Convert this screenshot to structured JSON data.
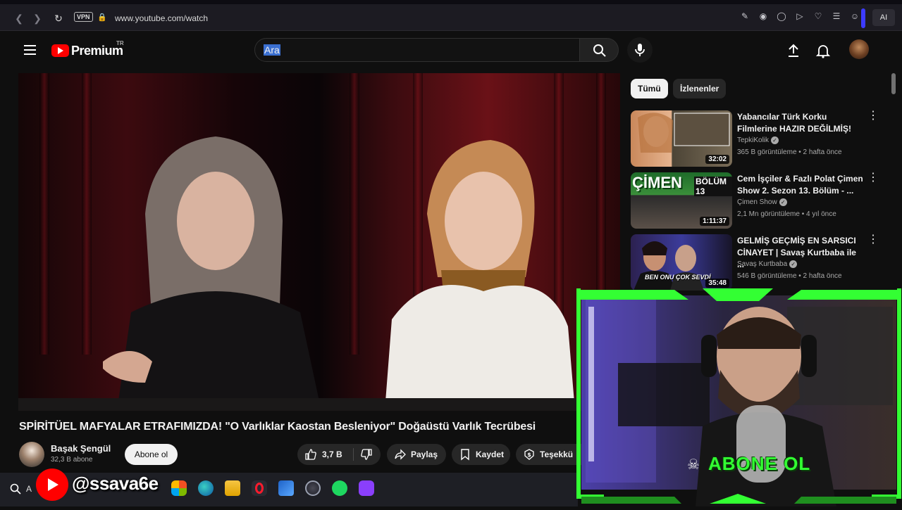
{
  "browser": {
    "vpn_label": "VPN",
    "url": "www.youtube.com/watch",
    "ai_label": "AI"
  },
  "header": {
    "logo_text": "Premium",
    "logo_country": "TR",
    "search_placeholder": "Ara"
  },
  "video": {
    "title": "SPİRİTÜEL MAFYALAR ETRAFIMIZDA! \"O Varlıklar Kaostan Besleniyor\" Doğaüstü Varlık Tecrübesi",
    "channel_name": "Başak Şengül",
    "subscribers": "32,3 B abone",
    "subscribe_label": "Abone ol",
    "likes": "3,7 B",
    "share_label": "Paylaş",
    "save_label": "Kaydet",
    "thanks_label": "Teşekkü"
  },
  "sidebar": {
    "chips": [
      "Tümü",
      "İzlenenler"
    ],
    "recommendations": [
      {
        "title": "Yabancılar Türk Korku Filmlerine HAZIR DEĞİLMİŞ!",
        "channel": "TepkiKolik",
        "meta": "365 B görüntüleme • 2 hafta önce",
        "duration": "32:02"
      },
      {
        "title": "Cem İşçiler & Fazlı Polat Çimen Show 2. Sezon 13. Bölüm - ...",
        "channel": "Çimen Show",
        "meta": "2,1 Mn görüntüleme • 4 yıl önce",
        "duration": "1:11:37",
        "thumb_text_1": "ÇİMEN",
        "thumb_text_2": "BÖLÜM 13"
      },
      {
        "title": "GELMİŞ GEÇMİŞ EN SARSICI CİNAYET | Savaş Kurtbaba ile ...",
        "channel": "Savaş Kurtbaba",
        "meta": "546 B görüntüleme • 2 hafta önce",
        "duration": "35:48",
        "thumb_text_1": "BEN ONU ÇOK SEVDİ"
      }
    ]
  },
  "overlay": {
    "handle": "@ssava6e",
    "abone_banner": "ABONE OL"
  },
  "taskbar": {
    "search_stub": "A"
  },
  "colors": {
    "youtube_red": "#ff0000",
    "neon_green": "#33ff33",
    "background": "#0f0f0f"
  }
}
